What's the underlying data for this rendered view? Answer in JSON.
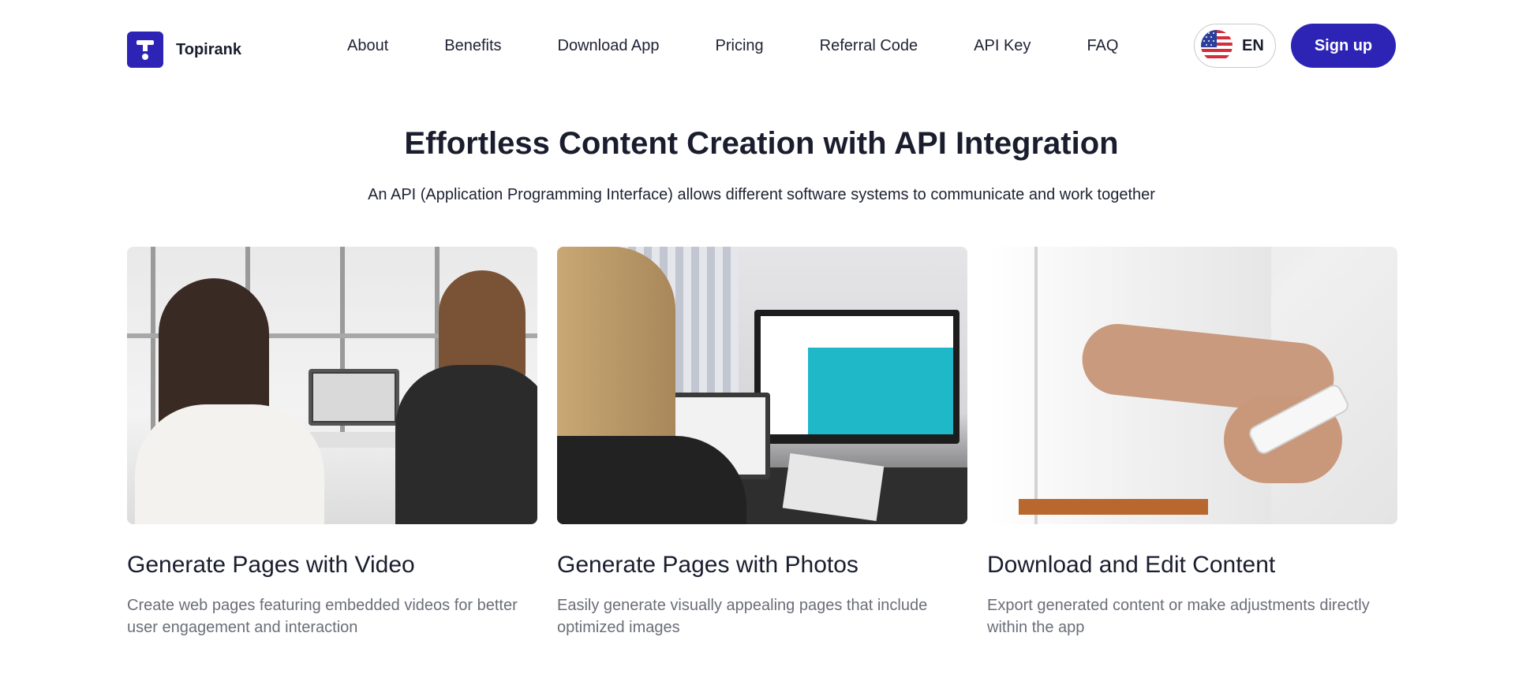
{
  "brand": {
    "name": "Topirank"
  },
  "nav": {
    "items": [
      {
        "label": "About"
      },
      {
        "label": "Benefits"
      },
      {
        "label": "Download App"
      },
      {
        "label": "Pricing"
      },
      {
        "label": "Referral Code"
      },
      {
        "label": "API Key"
      },
      {
        "label": "FAQ"
      }
    ]
  },
  "language": {
    "code": "EN",
    "flag": "us-flag-icon"
  },
  "signup": {
    "label": "Sign up"
  },
  "hero": {
    "title": "Effortless Content Creation with API Integration",
    "subtitle": "An API (Application Programming Interface) allows different software systems to communicate and work together"
  },
  "cards": [
    {
      "title": "Generate Pages with Video",
      "description": "Create web pages featuring embedded videos for better user engagement and interaction"
    },
    {
      "title": "Generate Pages with Photos",
      "description": "Easily generate visually appealing pages that include optimized images"
    },
    {
      "title": "Download and Edit Content",
      "description": "Export generated content or make adjustments directly within the app"
    }
  ],
  "colors": {
    "brand": "#2d24b5",
    "text": "#1a1d2e",
    "muted": "#6b6e78"
  }
}
